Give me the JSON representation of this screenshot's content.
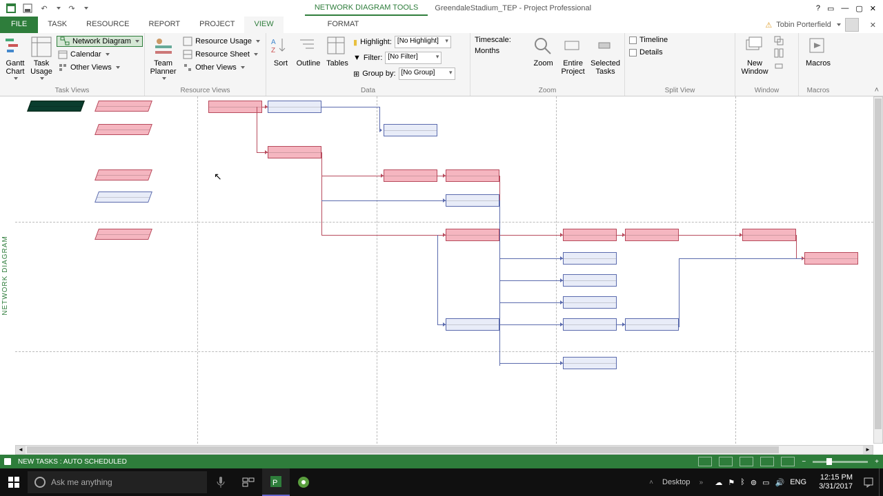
{
  "qat": {
    "undo": "↶",
    "redo": "↷"
  },
  "title": {
    "tool_context": "NETWORK DIAGRAM TOOLS",
    "document": "GreendaleStadium_TEP - Project Professional"
  },
  "tabs": {
    "file": "FILE",
    "task": "TASK",
    "resource": "RESOURCE",
    "report": "REPORT",
    "project": "PROJECT",
    "view": "VIEW",
    "format": "FORMAT"
  },
  "user": {
    "name": "Tobin Porterfield"
  },
  "ribbon": {
    "task_views": {
      "group_label": "Task Views",
      "gantt": "Gantt Chart",
      "task_usage": "Task Usage",
      "network_diagram": "Network Diagram",
      "calendar": "Calendar",
      "other_views": "Other Views"
    },
    "resource_views": {
      "group_label": "Resource Views",
      "team_planner": "Team Planner",
      "resource_usage": "Resource Usage",
      "resource_sheet": "Resource Sheet",
      "other_views": "Other Views"
    },
    "data": {
      "group_label": "Data",
      "sort": "Sort",
      "outline": "Outline",
      "tables": "Tables",
      "highlight": "Highlight:",
      "highlight_val": "[No Highlight]",
      "filter": "Filter:",
      "filter_val": "[No Filter]",
      "group_by": "Group by:",
      "group_val": "[No Group]"
    },
    "zoom": {
      "group_label": "Zoom",
      "timescale": "Timescale:",
      "timescale_val": "Months",
      "zoom": "Zoom",
      "entire": "Entire Project",
      "selected": "Selected Tasks"
    },
    "split_view": {
      "group_label": "Split View",
      "timeline": "Timeline",
      "details": "Details"
    },
    "window": {
      "group_label": "Window",
      "new_window": "New Window"
    },
    "macros": {
      "group_label": "Macros",
      "macros": "Macros"
    }
  },
  "side_label": "NETWORK DIAGRAM",
  "status": {
    "new_tasks": "NEW TASKS : AUTO SCHEDULED"
  },
  "taskbar": {
    "search_placeholder": "Ask me anything",
    "desktop": "Desktop",
    "lang": "ENG",
    "time": "12:15 PM",
    "date": "3/31/2017"
  },
  "colors": {
    "accent": "#2e7d3b",
    "critical": "#f5b6c0",
    "noncritical": "#e8ecf8"
  }
}
